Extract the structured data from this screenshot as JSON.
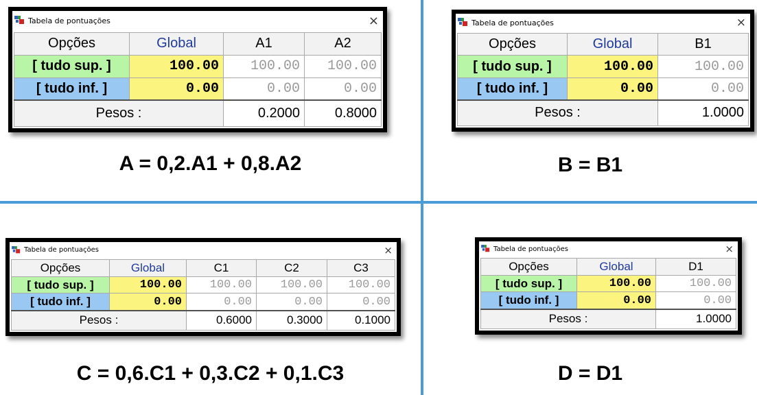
{
  "colors": {
    "divider": "#4a9bd6",
    "sup_bg": "#b9f5a6",
    "inf_bg": "#99c9f2",
    "global_bg": "#fbf57f",
    "global_header_text": "#1f3b9a"
  },
  "windows": [
    {
      "title": "Tabela de pontuações",
      "close": "×",
      "header": {
        "opcoes": "Opções",
        "global": "Global",
        "criteria": [
          "A1",
          "A2"
        ]
      },
      "sup": {
        "label": "[ tudo sup. ]",
        "global": "100.00",
        "values": [
          "100.00",
          "100.00"
        ]
      },
      "inf": {
        "label": "[ tudo inf. ]",
        "global": "0.00",
        "values": [
          "0.00",
          "0.00"
        ]
      },
      "pesos": {
        "label": "Pesos :",
        "values": [
          "0.2000",
          "0.8000"
        ]
      },
      "formula": "A = 0,2.A1 + 0,8.A2"
    },
    {
      "title": "Tabela de pontuações",
      "close": "×",
      "header": {
        "opcoes": "Opções",
        "global": "Global",
        "criteria": [
          "B1"
        ]
      },
      "sup": {
        "label": "[ tudo sup. ]",
        "global": "100.00",
        "values": [
          "100.00"
        ]
      },
      "inf": {
        "label": "[ tudo inf. ]",
        "global": "0.00",
        "values": [
          "0.00"
        ]
      },
      "pesos": {
        "label": "Pesos :",
        "values": [
          "1.0000"
        ]
      },
      "formula": "B = B1"
    },
    {
      "title": "Tabela de pontuações",
      "close": "×",
      "header": {
        "opcoes": "Opções",
        "global": "Global",
        "criteria": [
          "C1",
          "C2",
          "C3"
        ]
      },
      "sup": {
        "label": "[ tudo sup. ]",
        "global": "100.00",
        "values": [
          "100.00",
          "100.00",
          "100.00"
        ]
      },
      "inf": {
        "label": "[ tudo inf. ]",
        "global": "0.00",
        "values": [
          "0.00",
          "0.00",
          "0.00"
        ]
      },
      "pesos": {
        "label": "Pesos :",
        "values": [
          "0.6000",
          "0.3000",
          "0.1000"
        ]
      },
      "formula": "C = 0,6.C1 + 0,3.C2 + 0,1.C3"
    },
    {
      "title": "Tabela de pontuações",
      "close": "×",
      "header": {
        "opcoes": "Opções",
        "global": "Global",
        "criteria": [
          "D1"
        ]
      },
      "sup": {
        "label": "[ tudo sup. ]",
        "global": "100.00",
        "values": [
          "100.00"
        ]
      },
      "inf": {
        "label": "[ tudo inf. ]",
        "global": "0.00",
        "values": [
          "0.00"
        ]
      },
      "pesos": {
        "label": "Pesos :",
        "values": [
          "1.0000"
        ]
      },
      "formula": "D = D1"
    }
  ]
}
